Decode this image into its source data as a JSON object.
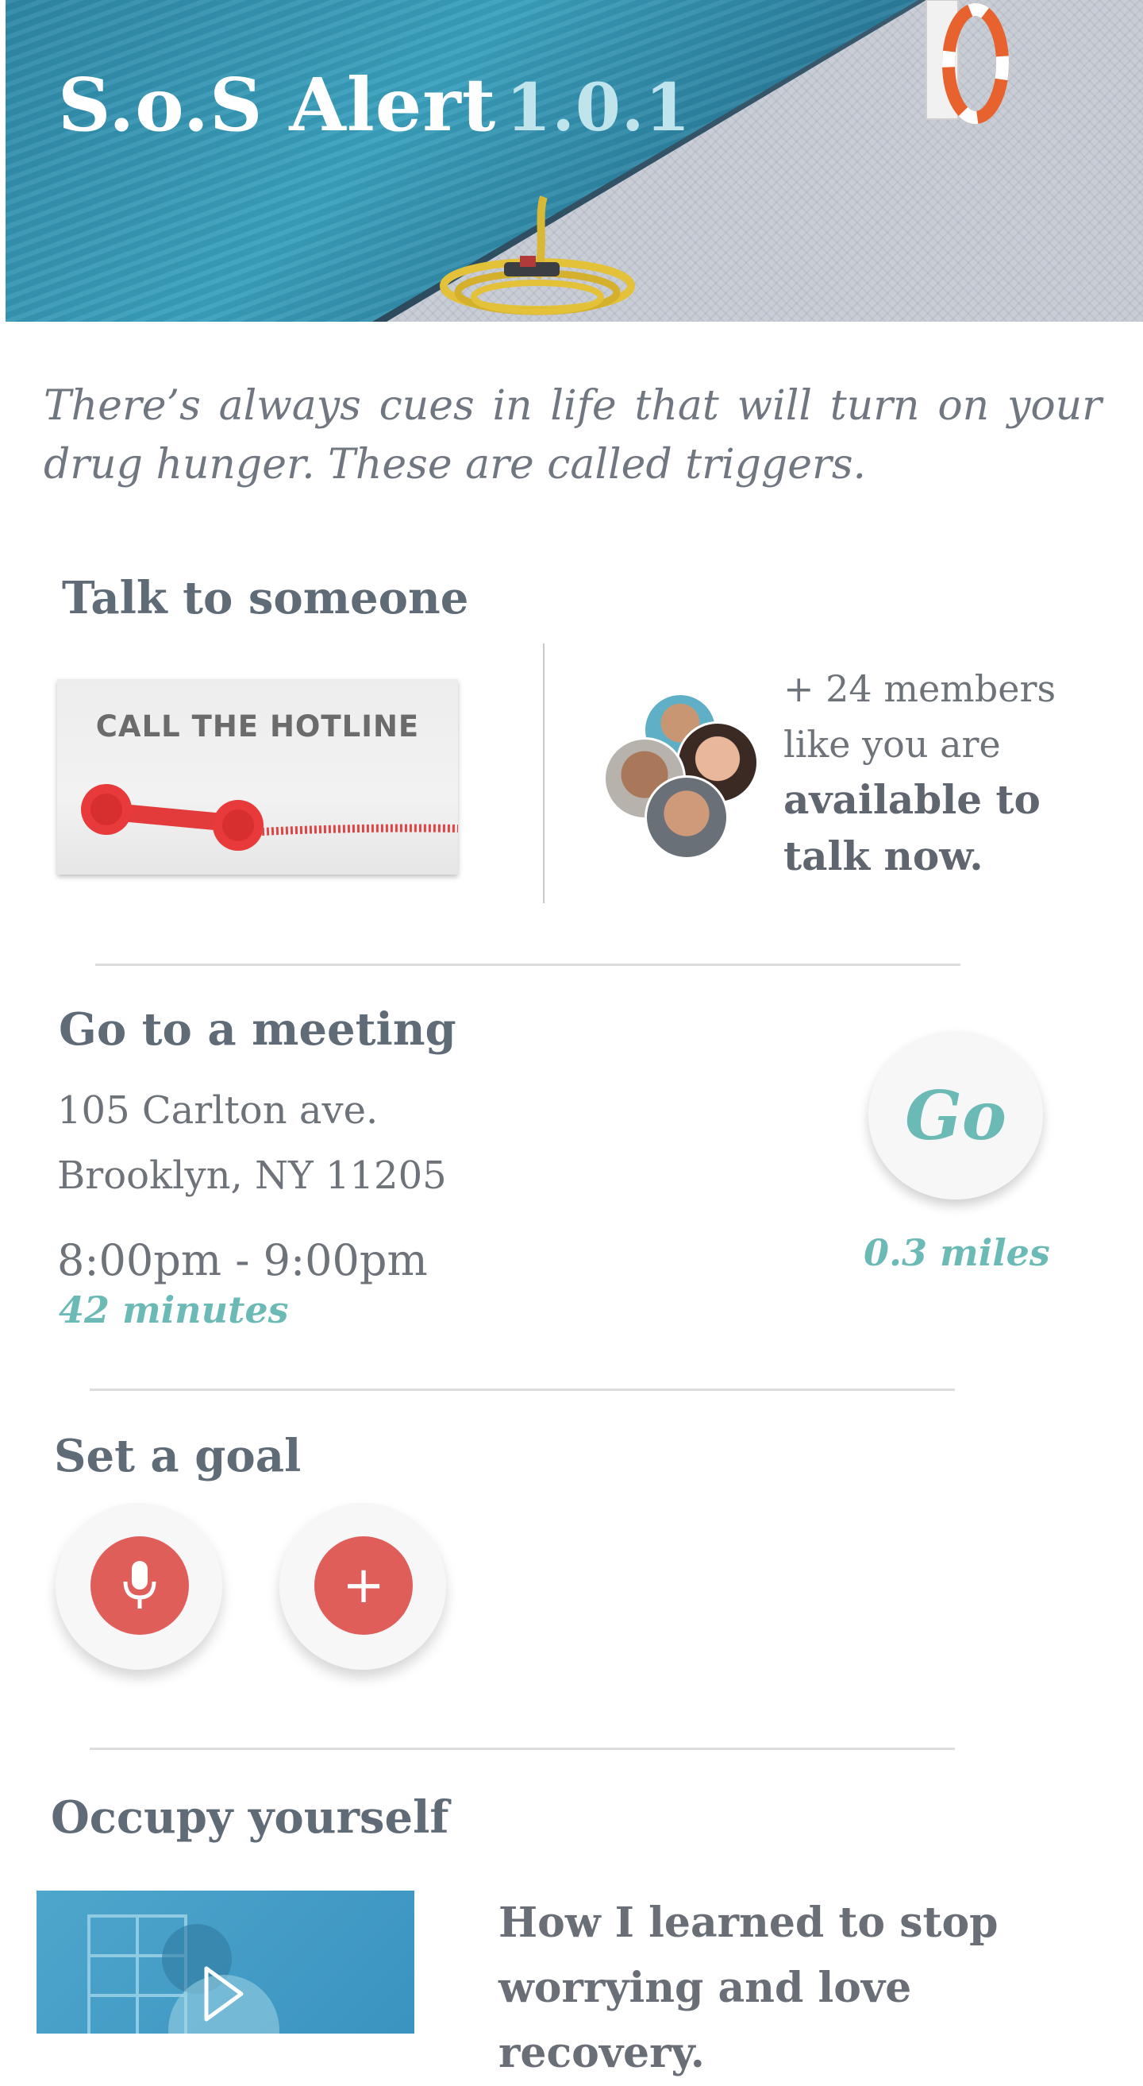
{
  "app": {
    "title": "S.o.S Alert",
    "version": "1.0.1"
  },
  "intro": "There’s always cues in life that will turn on your drug hunger. These are called triggers.",
  "talk": {
    "heading": "Talk to someone",
    "hotline_label": "CALL THE HOTLINE",
    "members_line1": "+ 24 members like you are",
    "members_line2": "available to talk now."
  },
  "meeting": {
    "heading": "Go to a meeting",
    "address_line1": "105 Carlton ave.",
    "address_line2": "Brooklyn, NY 11205",
    "time": "8:00pm - 9:00pm",
    "duration": "42 minutes",
    "go_label": "Go",
    "distance": "0.3 miles"
  },
  "goal": {
    "heading": "Set a goal",
    "buttons": [
      {
        "icon": "microphone-icon"
      },
      {
        "icon": "plus-icon",
        "glyph": "+"
      }
    ]
  },
  "occupy": {
    "heading": "Occupy yourself",
    "article_title": "How I learned to stop worrying and love recovery."
  },
  "colors": {
    "accent_teal": "#6cbab6",
    "accent_red": "#e05e5a",
    "heading_gray": "#606b78"
  }
}
